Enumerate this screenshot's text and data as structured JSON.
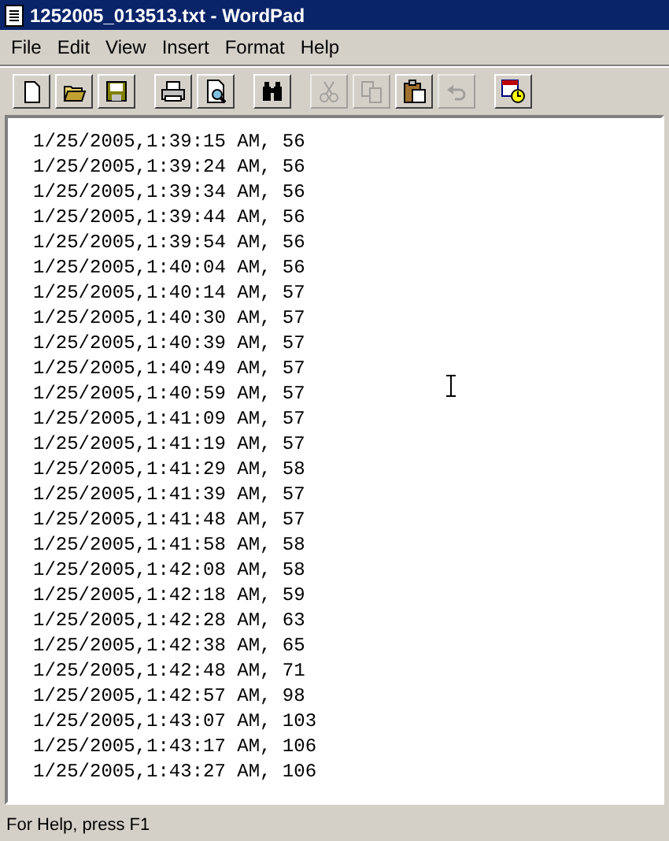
{
  "window": {
    "title": "1252005_013513.txt - WordPad"
  },
  "menu": [
    "File",
    "Edit",
    "View",
    "Insert",
    "Format",
    "Help"
  ],
  "toolbar": [
    {
      "kind": "new",
      "disabled": false
    },
    {
      "kind": "open",
      "disabled": false
    },
    {
      "kind": "save",
      "disabled": false
    },
    {
      "kind": "print",
      "disabled": false
    },
    {
      "kind": "preview",
      "disabled": false
    },
    {
      "kind": "find",
      "disabled": false
    },
    {
      "kind": "cut",
      "disabled": true
    },
    {
      "kind": "copy",
      "disabled": true
    },
    {
      "kind": "paste",
      "disabled": false
    },
    {
      "kind": "undo",
      "disabled": true
    },
    {
      "kind": "datetime",
      "disabled": false
    }
  ],
  "document": {
    "lines": [
      "1/25/2005,1:39:15 AM, 56",
      "1/25/2005,1:39:24 AM, 56",
      "1/25/2005,1:39:34 AM, 56",
      "1/25/2005,1:39:44 AM, 56",
      "1/25/2005,1:39:54 AM, 56",
      "1/25/2005,1:40:04 AM, 56",
      "1/25/2005,1:40:14 AM, 57",
      "1/25/2005,1:40:30 AM, 57",
      "1/25/2005,1:40:39 AM, 57",
      "1/25/2005,1:40:49 AM, 57",
      "1/25/2005,1:40:59 AM, 57",
      "1/25/2005,1:41:09 AM, 57",
      "1/25/2005,1:41:19 AM, 57",
      "1/25/2005,1:41:29 AM, 58",
      "1/25/2005,1:41:39 AM, 57",
      "1/25/2005,1:41:48 AM, 57",
      "1/25/2005,1:41:58 AM, 58",
      "1/25/2005,1:42:08 AM, 58",
      "1/25/2005,1:42:18 AM, 59",
      "1/25/2005,1:42:28 AM, 63",
      "1/25/2005,1:42:38 AM, 65",
      "1/25/2005,1:42:48 AM, 71",
      "1/25/2005,1:42:57 AM, 98",
      "1/25/2005,1:43:07 AM, 103",
      "1/25/2005,1:43:17 AM, 106",
      "1/25/2005,1:43:27 AM, 106"
    ]
  },
  "status_bar": "For Help, press F1"
}
